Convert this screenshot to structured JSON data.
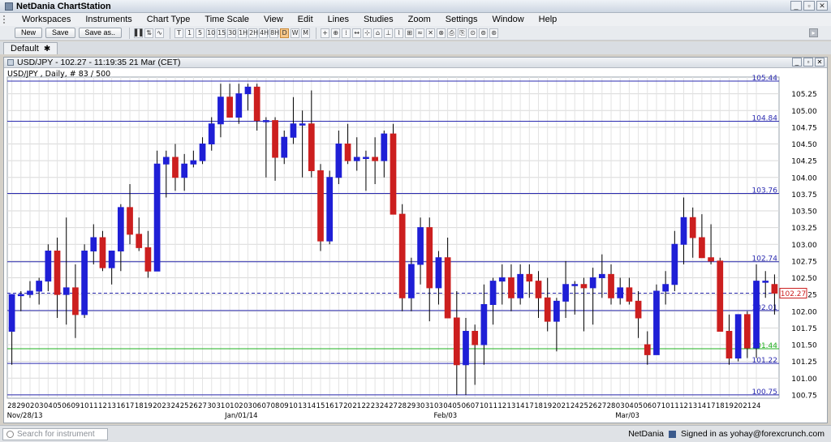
{
  "window": {
    "title": "NetDania ChartStation",
    "buttons": [
      "_",
      "▫",
      "✕"
    ]
  },
  "menu": [
    "Workspaces",
    "Instruments",
    "Chart Type",
    "Time Scale",
    "View",
    "Edit",
    "Lines",
    "Studies",
    "Zoom",
    "Settings",
    "Window",
    "Help"
  ],
  "toolbar": {
    "new_label": "New",
    "save_label": "Save",
    "saveas_label": "Save as..",
    "tools": [
      "▌▌",
      "⇅",
      "∿"
    ],
    "timeframes": [
      "T",
      "1",
      "5",
      "10",
      "15",
      "30",
      "1H",
      "2H",
      "4H",
      "8H",
      "D",
      "W",
      "M"
    ],
    "active_timeframe": "D",
    "draw_tools": [
      "+",
      "⊕",
      "⁞",
      "↔",
      "⊹",
      "⌂",
      "⊥",
      "⌇",
      "⊞",
      "≈",
      "✕",
      "⊗",
      "⎙",
      "⎘",
      "⊙",
      "⊚",
      "⊛"
    ],
    "right_icon": "▸"
  },
  "tab": {
    "label": "Default",
    "close": "✱"
  },
  "panel": {
    "title": "USD/JPY - 102.27 - 11:19:35  21 Mar (CET)",
    "info": "USD/JPY , Daily, # 83 / 500",
    "buttons": [
      "_",
      "▫",
      "✕"
    ]
  },
  "colors": {
    "up": "#1f1fd6",
    "down": "#cc1f1f",
    "hline": "#2b2bb0",
    "green_line": "#22b022"
  },
  "chart_data": {
    "type": "candlestick",
    "instrument": "USD/JPY",
    "current_price": "102.27",
    "ylim": [
      100.7,
      105.5
    ],
    "yticks": [
      "105.25",
      "105.00",
      "104.75",
      "104.50",
      "104.25",
      "104.00",
      "103.75",
      "103.50",
      "103.25",
      "103.00",
      "102.75",
      "102.50",
      "102.25",
      "102.00",
      "101.75",
      "101.50",
      "101.25",
      "101.00",
      "100.75"
    ],
    "hlines": [
      {
        "value": 105.44,
        "label": "105.44",
        "color": "blue"
      },
      {
        "value": 104.84,
        "label": "104.84",
        "color": "blue"
      },
      {
        "value": 103.76,
        "label": "103.76",
        "color": "blue"
      },
      {
        "value": 102.74,
        "label": "102.74",
        "color": "blue"
      },
      {
        "value": 102.01,
        "label": "102.01",
        "color": "blue"
      },
      {
        "value": 101.44,
        "label": "101.44",
        "color": "green"
      },
      {
        "value": 101.22,
        "label": "101.22",
        "color": "blue"
      },
      {
        "value": 100.75,
        "label": "100.75",
        "color": "blue"
      }
    ],
    "xticks": [
      "28",
      "29",
      "02",
      "03",
      "04",
      "05",
      "06",
      "09",
      "10",
      "11",
      "12",
      "13",
      "16",
      "17",
      "18",
      "19",
      "20",
      "23",
      "24",
      "25",
      "26",
      "27",
      "30",
      "31",
      "01",
      "02",
      "03",
      "06",
      "07",
      "08",
      "09",
      "10",
      "13",
      "14",
      "15",
      "16",
      "17",
      "20",
      "21",
      "22",
      "23",
      "24",
      "27",
      "28",
      "29",
      "30",
      "31",
      "03",
      "04",
      "05",
      "06",
      "07",
      "10",
      "11",
      "12",
      "13",
      "14",
      "17",
      "18",
      "19",
      "20",
      "21",
      "24",
      "25",
      "26",
      "27",
      "28",
      "03",
      "04",
      "05",
      "06",
      "07",
      "10",
      "11",
      "12",
      "13",
      "14",
      "17",
      "18",
      "19",
      "20",
      "21",
      "24"
    ],
    "xmajor": [
      {
        "index": 0,
        "label": "Nov/28/13"
      },
      {
        "index": 24,
        "label": "Jan/01/14"
      },
      {
        "index": 47,
        "label": "Feb/03"
      },
      {
        "index": 67,
        "label": "Mar/03"
      }
    ],
    "candles": [
      [
        101.7,
        102.25,
        101.2,
        102.25
      ],
      [
        102.25,
        102.3,
        102.0,
        102.25
      ],
      [
        102.25,
        102.45,
        102.2,
        102.3
      ],
      [
        102.3,
        102.5,
        102.1,
        102.45
      ],
      [
        102.45,
        103.0,
        102.3,
        102.9
      ],
      [
        102.9,
        103.1,
        101.9,
        102.25
      ],
      [
        102.25,
        103.4,
        101.8,
        102.35
      ],
      [
        102.35,
        102.7,
        101.6,
        101.95
      ],
      [
        101.95,
        103.0,
        101.9,
        102.9
      ],
      [
        102.9,
        103.3,
        102.7,
        103.1
      ],
      [
        103.1,
        103.2,
        102.6,
        102.65
      ],
      [
        102.65,
        102.9,
        102.4,
        102.9
      ],
      [
        102.9,
        103.6,
        102.6,
        103.55
      ],
      [
        103.55,
        103.9,
        103.0,
        103.15
      ],
      [
        103.15,
        103.4,
        102.9,
        102.95
      ],
      [
        102.95,
        103.2,
        102.5,
        102.6
      ],
      [
        102.6,
        104.4,
        102.6,
        104.2
      ],
      [
        104.2,
        104.4,
        103.7,
        104.3
      ],
      [
        104.3,
        104.5,
        103.8,
        104.0
      ],
      [
        104.0,
        104.35,
        103.8,
        104.2
      ],
      [
        104.2,
        104.4,
        104.15,
        104.25
      ],
      [
        104.25,
        104.6,
        104.2,
        104.5
      ],
      [
        104.5,
        104.9,
        104.4,
        104.8
      ],
      [
        104.8,
        105.4,
        104.6,
        105.2
      ],
      [
        105.2,
        105.4,
        104.9,
        104.9
      ],
      [
        104.9,
        105.4,
        104.8,
        105.25
      ],
      [
        105.25,
        105.4,
        105.0,
        105.35
      ],
      [
        105.35,
        105.4,
        104.7,
        104.85
      ],
      [
        104.85,
        104.9,
        104.0,
        104.85
      ],
      [
        104.85,
        104.9,
        103.95,
        104.3
      ],
      [
        104.3,
        104.7,
        104.2,
        104.6
      ],
      [
        104.6,
        105.2,
        104.5,
        104.8
      ],
      [
        104.8,
        105.0,
        104.0,
        104.8
      ],
      [
        104.8,
        105.3,
        104.0,
        104.1
      ],
      [
        104.1,
        104.2,
        102.9,
        103.05
      ],
      [
        103.05,
        104.1,
        103.0,
        104.0
      ],
      [
        104.0,
        104.7,
        103.9,
        104.5
      ],
      [
        104.5,
        104.8,
        104.2,
        104.25
      ],
      [
        104.25,
        104.6,
        104.1,
        104.3
      ],
      [
        104.3,
        104.4,
        103.8,
        104.3
      ],
      [
        104.3,
        104.6,
        103.9,
        104.25
      ],
      [
        104.25,
        104.7,
        104.0,
        104.65
      ],
      [
        104.65,
        104.8,
        103.7,
        103.45
      ],
      [
        103.45,
        103.6,
        102.0,
        102.2
      ],
      [
        102.2,
        102.8,
        102.0,
        102.7
      ],
      [
        102.7,
        103.4,
        102.4,
        103.25
      ],
      [
        103.25,
        103.4,
        101.85,
        102.35
      ],
      [
        102.35,
        102.9,
        102.1,
        102.8
      ],
      [
        102.8,
        103.1,
        101.9,
        101.9
      ],
      [
        101.9,
        102.3,
        100.75,
        101.2
      ],
      [
        101.2,
        101.9,
        100.75,
        101.7
      ],
      [
        101.7,
        101.8,
        100.9,
        101.5
      ],
      [
        101.5,
        102.4,
        101.2,
        102.1
      ],
      [
        102.1,
        102.5,
        101.8,
        102.45
      ],
      [
        102.45,
        102.7,
        102.1,
        102.5
      ],
      [
        102.5,
        102.7,
        102.0,
        102.2
      ],
      [
        102.2,
        102.7,
        102.1,
        102.55
      ],
      [
        102.55,
        102.7,
        102.2,
        102.45
      ],
      [
        102.45,
        102.6,
        101.9,
        102.2
      ],
      [
        102.2,
        102.5,
        101.7,
        101.85
      ],
      [
        101.85,
        102.2,
        101.4,
        102.15
      ],
      [
        102.15,
        102.75,
        101.9,
        102.4
      ],
      [
        102.4,
        102.45,
        101.95,
        102.4
      ],
      [
        102.4,
        102.5,
        101.7,
        102.35
      ],
      [
        102.35,
        102.65,
        101.8,
        102.5
      ],
      [
        102.5,
        102.85,
        102.2,
        102.55
      ],
      [
        102.55,
        102.7,
        102.1,
        102.2
      ],
      [
        102.2,
        102.5,
        102.1,
        102.35
      ],
      [
        102.35,
        102.5,
        102.1,
        102.15
      ],
      [
        102.15,
        102.3,
        101.6,
        101.9
      ],
      [
        101.5,
        101.7,
        101.2,
        101.35
      ],
      [
        101.35,
        102.4,
        101.35,
        102.3
      ],
      [
        102.3,
        102.6,
        102.1,
        102.4
      ],
      [
        102.4,
        103.2,
        102.3,
        103.0
      ],
      [
        103.0,
        103.7,
        102.7,
        103.4
      ],
      [
        103.4,
        103.55,
        102.8,
        103.1
      ],
      [
        103.1,
        103.45,
        102.8,
        102.8
      ],
      [
        102.8,
        103.3,
        102.7,
        102.75
      ],
      [
        102.75,
        102.8,
        101.7,
        101.7
      ],
      [
        101.7,
        101.95,
        101.2,
        101.3
      ],
      [
        101.3,
        101.9,
        101.25,
        101.95
      ],
      [
        101.95,
        102.0,
        101.3,
        101.45
      ],
      [
        101.45,
        102.7,
        101.3,
        102.45
      ],
      [
        102.45,
        102.6,
        102.2,
        102.45
      ],
      [
        102.4,
        102.55,
        101.95,
        102.27
      ]
    ]
  },
  "status": {
    "search_placeholder": "Search for instrument",
    "brand": "NetDania",
    "signed_in": "Signed in as yohay@forexcrunch.com"
  }
}
